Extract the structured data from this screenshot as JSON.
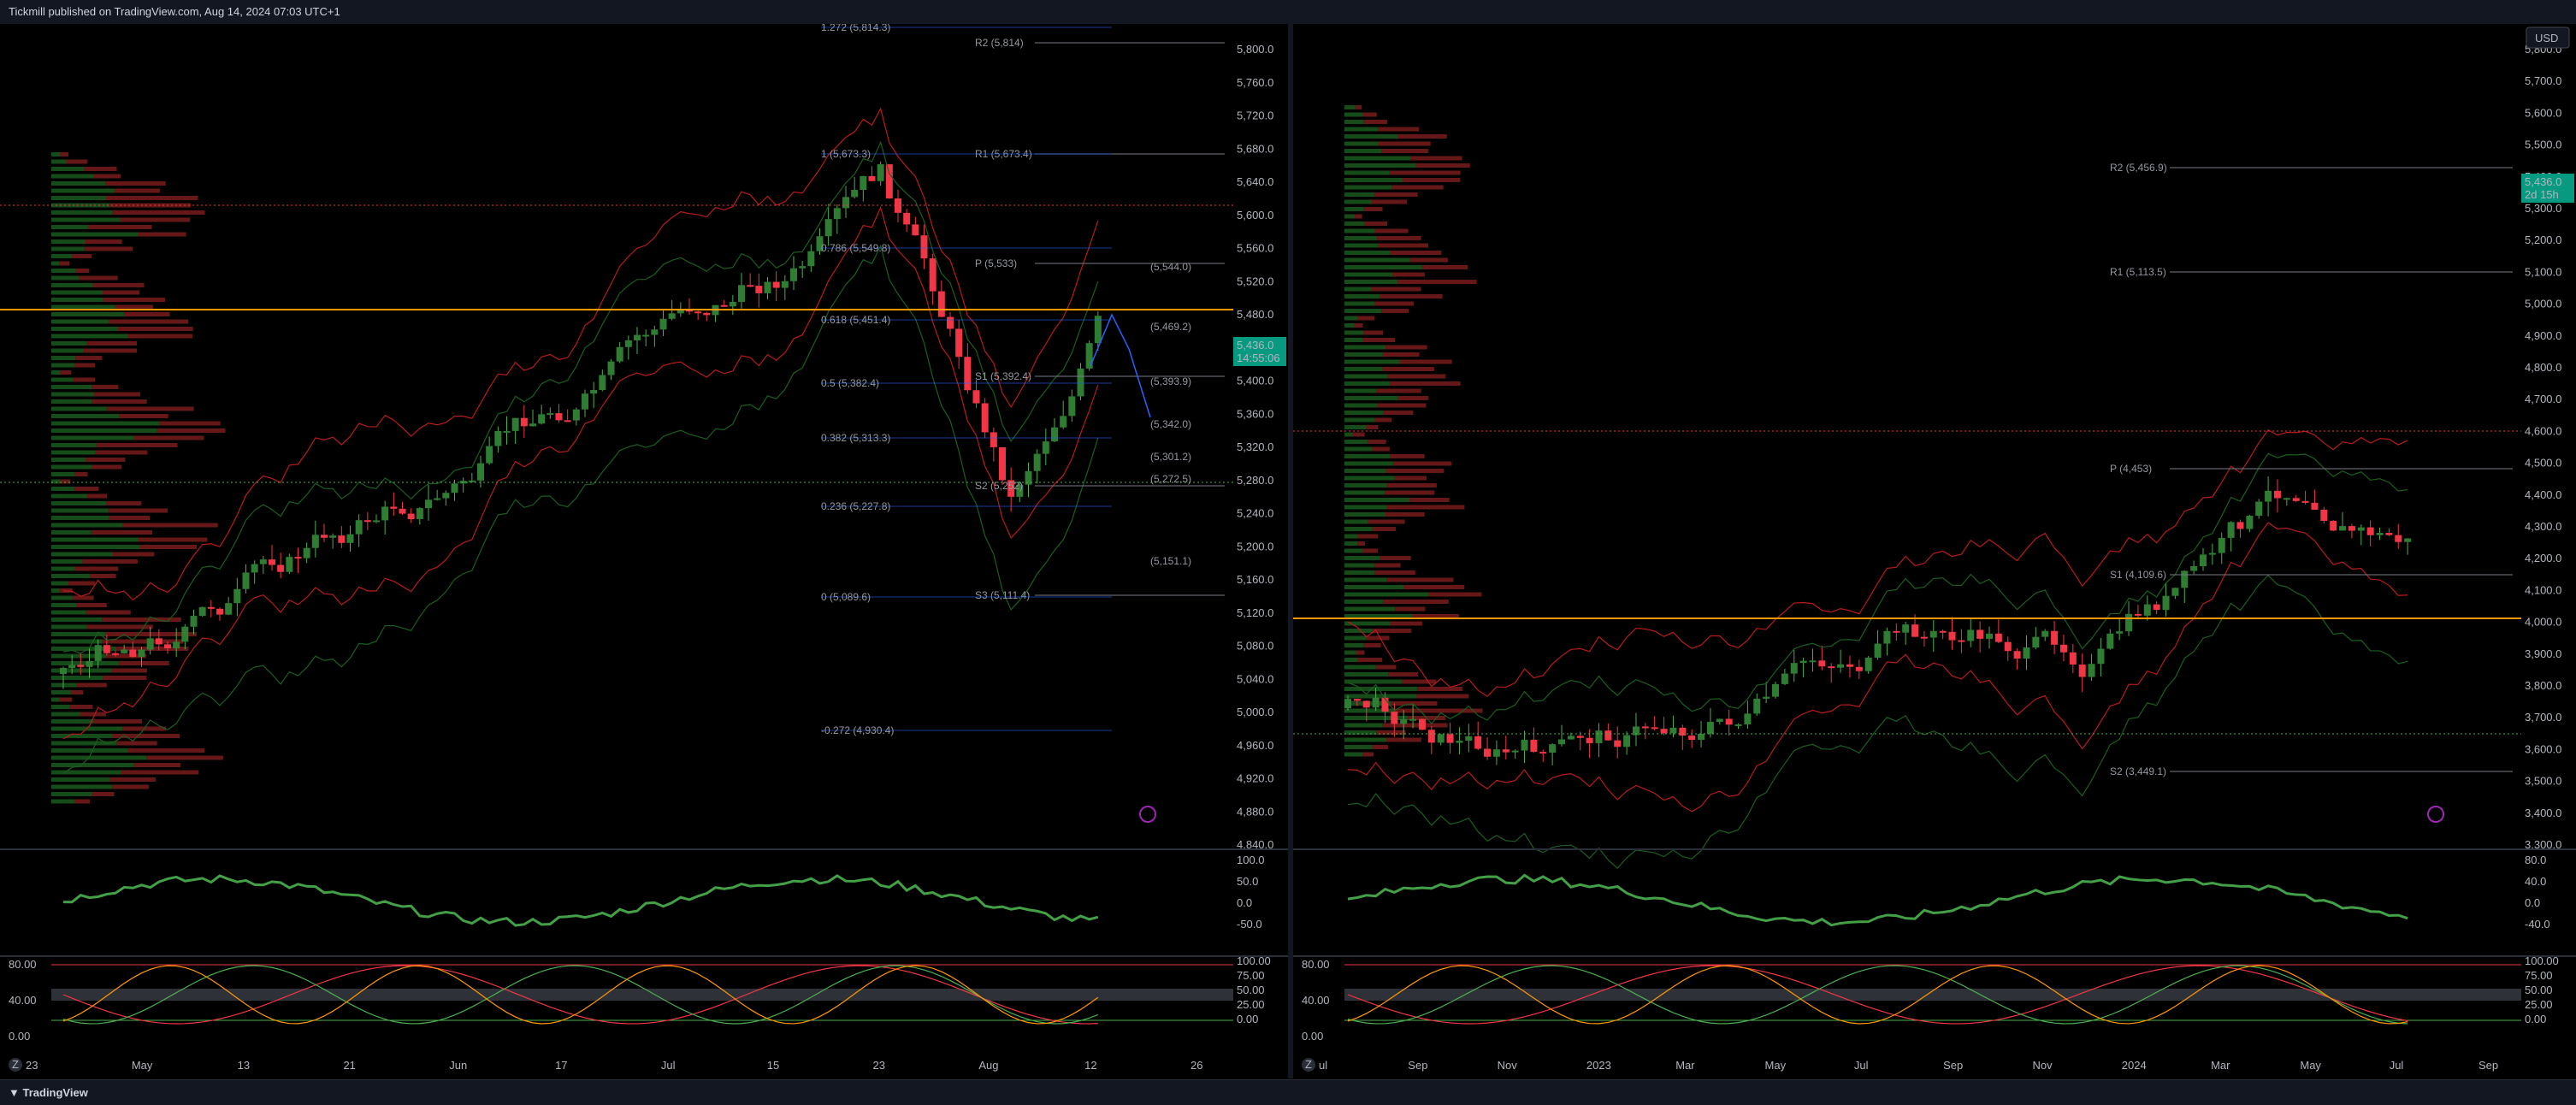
{
  "header": {
    "publisher": "Tickmill published on TradingView.com, Aug 14, 2024 07:03 UTC+1"
  },
  "footer": {
    "brand": "TradingView",
    "zoom_label": "Z"
  },
  "left": {
    "price_axis": [
      "5,800.0",
      "5,760.0",
      "5,720.0",
      "5,680.0",
      "5,640.0",
      "5,600.0",
      "5,560.0",
      "5,520.0",
      "5,480.0",
      "5,440.0",
      "5,400.0",
      "5,360.0",
      "5,320.0",
      "5,280.0",
      "5,240.0",
      "5,200.0",
      "5,160.0",
      "5,120.0",
      "5,080.0",
      "5,040.0",
      "5,000.0",
      "4,960.0",
      "4,920.0",
      "4,880.0",
      "4,840.0"
    ],
    "last_price": "5,436.0",
    "countdown": "14:55:06",
    "time_axis": [
      "23",
      "May",
      "13",
      "21",
      "Jun",
      "17",
      "Jul",
      "15",
      "23",
      "Aug",
      "12",
      "26"
    ],
    "fib_labels": [
      "1.272 (5,814.3)",
      "1 (5,673.3)",
      "0.786 (5,549.8)",
      "0.618 (5,451.4)",
      "0.5 (5,382.4)",
      "0.382 (5,313.3)",
      "0.236 (5,227.8)",
      "0 (5,089.6)",
      "-0.272 (4,930.4)"
    ],
    "pivot_labels": [
      "R2 (5,814)",
      "R1 (5,673.4)",
      "P (5,533)",
      "S1 (5,392.4)",
      "S2 (5,252)",
      "S3 (5,111.4)"
    ],
    "level_labels": [
      "(5,544.0)",
      "(5,469.2)",
      "(5,393.9)",
      "(5,342.0)",
      "(5,301.2)",
      "(5,272.5)",
      "(5,151.1)"
    ],
    "osc1_axis": [
      "100.0",
      "50.0",
      "0.0",
      "-50.0"
    ],
    "osc2_left_axis": [
      "80.00",
      "40.00",
      "0.00"
    ],
    "osc2_right_axis": [
      "100.00",
      "75.00",
      "50.00",
      "25.00",
      "0.00"
    ]
  },
  "right": {
    "currency": "USD",
    "price_axis": [
      "5,800.0",
      "5,700.0",
      "5,600.0",
      "5,500.0",
      "5,400.0",
      "5,300.0",
      "5,200.0",
      "5,100.0",
      "5,000.0",
      "4,900.0",
      "4,800.0",
      "4,700.0",
      "4,600.0",
      "4,500.0",
      "4,400.0",
      "4,300.0",
      "4,200.0",
      "4,100.0",
      "4,000.0",
      "3,900.0",
      "3,800.0",
      "3,700.0",
      "3,600.0",
      "3,500.0",
      "3,400.0",
      "3,300.0"
    ],
    "last_price": "5,436.0",
    "countdown": "2d 15h",
    "time_axis": [
      "ul",
      "Sep",
      "Nov",
      "2023",
      "Mar",
      "May",
      "Jul",
      "Sep",
      "Nov",
      "2024",
      "Mar",
      "May",
      "Jul",
      "Sep"
    ],
    "pivot_labels": [
      "R2 (5,456.9)",
      "R1 (5,113.5)",
      "P (4,453)",
      "S1 (4,109.6)",
      "S2 (3,449.1)"
    ],
    "osc1_axis": [
      "80.0",
      "40.0",
      "0.0",
      "-40.0"
    ],
    "osc2_left_axis": [
      "80.00",
      "40.00",
      "0.00"
    ],
    "osc2_right_axis": [
      "100.00",
      "75.00",
      "50.00",
      "25.00",
      "0.00"
    ]
  },
  "colors": {
    "up": "#089981",
    "up_green": "#2e7d32",
    "down": "#f23645",
    "orange": "#ff9800",
    "blue": "#2962ff",
    "purple": "#9c27b0"
  }
}
